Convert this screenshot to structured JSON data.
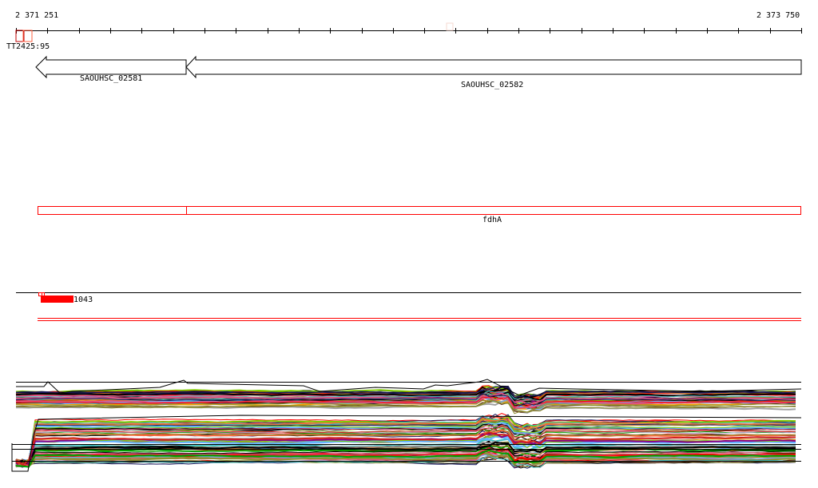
{
  "ruler": {
    "start_label": "2 371 251",
    "end_label": "2 373 750"
  },
  "features": {
    "marker_label": "TT2425:95",
    "genes": [
      {
        "name": "SAOUHSC_02581",
        "strand": "-"
      },
      {
        "name": "SAOUHSC_02582",
        "strand": "-"
      }
    ],
    "operon_label": "fdhA",
    "small_feature_label": "D1043"
  },
  "colors": {
    "accent_red": "#ff0000",
    "marker_red": "#c00000",
    "marker_orange": "#ff6040"
  },
  "tracks": {
    "line_palette": [
      "#000000",
      "#66b3ff",
      "#b0a0d0",
      "#ff6a3d",
      "#8b0080",
      "#7fcc00",
      "#c87533",
      "#8b8b2b",
      "#ff0000",
      "#00a000",
      "#e05080",
      "#1a1a60",
      "#a0a0a0",
      "#f0a000",
      "#40c0c0",
      "#603010",
      "#d02020",
      "#909030"
    ]
  }
}
